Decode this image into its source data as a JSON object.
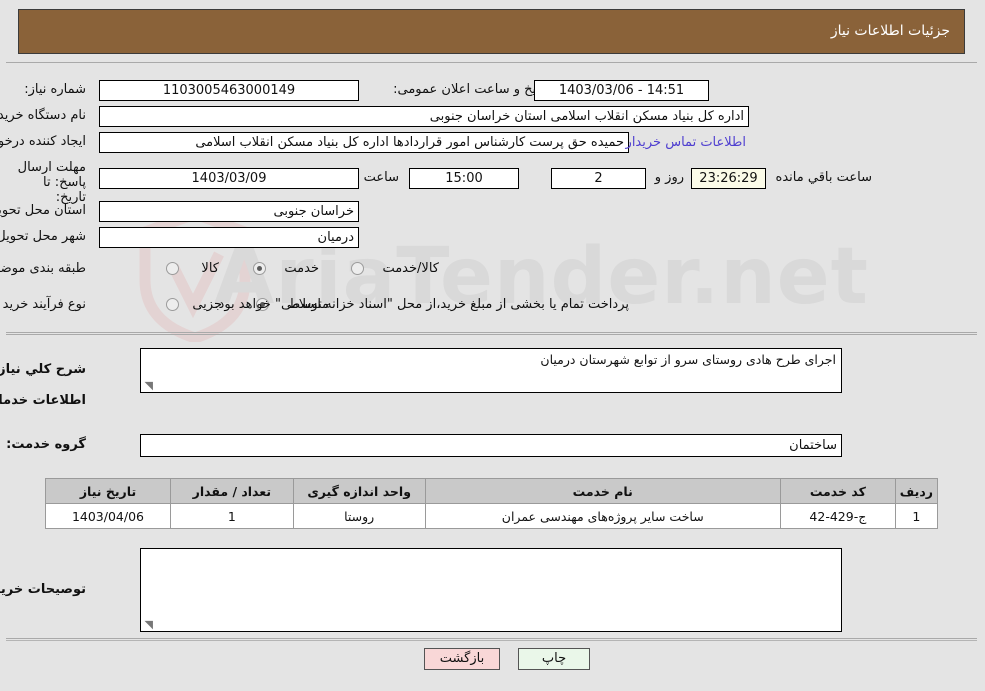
{
  "header": {
    "title": "جزئیات اطلاعات نیاز"
  },
  "watermark": {
    "text": "AriaTender.net"
  },
  "form": {
    "need_number_label": "شماره نیاز:",
    "need_number_value": "1103005463000149",
    "announce_label": "تاریخ و ساعت اعلان عمومی:",
    "announce_value": "14:51 - 1403/03/06",
    "buyer_org_label": "نام دستگاه خریدار:",
    "buyer_org_value": "اداره کل بنیاد مسکن انقلاب اسلامی استان خراسان جنوبی",
    "creator_label": "ایجاد کننده درخواست:",
    "creator_value": "حمیده حق پرست کارشناس امور قراردادها اداره کل بنیاد مسکن انقلاب اسلامی",
    "contact_link": "اطلاعات تماس خریدار",
    "deadline_label": "مهلت ارسال پاسخ: تا تاریخ:",
    "deadline_date": "1403/03/09",
    "hour_label": "ساعت",
    "hour_value": "15:00",
    "days_value": "2",
    "days_label": "روز و",
    "countdown_value": "23:26:29",
    "remaining_label": "ساعت باقي مانده",
    "province_label": "استان محل تحویل:",
    "province_value": "خراسان جنوبی",
    "city_label": "شهر محل تحویل:",
    "city_value": "درمیان",
    "category_label": "طبقه بندی موضوعی:",
    "category_options": [
      {
        "label": "کالا",
        "selected": false
      },
      {
        "label": "خدمت",
        "selected": true
      },
      {
        "label": "کالا/خدمت",
        "selected": false
      }
    ],
    "process_label": "نوع فرآیند خرید :",
    "process_options": [
      {
        "label": "جزیی",
        "selected": false
      },
      {
        "label": "متوسط",
        "selected": true
      }
    ],
    "payment_note": "پرداخت تمام یا بخشی از مبلغ خرید،از محل \"اسناد خزانه اسلامی\" خواهد بود."
  },
  "description": {
    "label": "شرح کلي نیاز:",
    "value": "اجرای طرح هادی روستای سرو از توابع شهرستان درمیان"
  },
  "services": {
    "section_title": "اطلاعات خدمات مورد نیاز",
    "group_label": "گروه خدمت:",
    "group_value": "ساختمان",
    "columns": [
      "ردیف",
      "کد خدمت",
      "نام خدمت",
      "واحد اندازه گیری",
      "تعداد / مقدار",
      "تاریخ نیاز"
    ],
    "rows": [
      {
        "row": "1",
        "code": "ج-429-42",
        "name": "ساخت سایر پروژه‌های مهندسی عمران",
        "unit": "روستا",
        "qty": "1",
        "date": "1403/04/06"
      }
    ]
  },
  "buyer_notes": {
    "label": "توصیحات خریدار;",
    "value": ""
  },
  "buttons": {
    "print": "چاپ",
    "back": "بازگشت"
  },
  "colors": {
    "header_bg": "#8a6239",
    "page_bg": "#e4e4e4",
    "link": "#4f3fd0",
    "print_btn": "#eaf7e9",
    "back_btn": "#f9d7d7",
    "countdown_bg": "#fbfbe8"
  }
}
